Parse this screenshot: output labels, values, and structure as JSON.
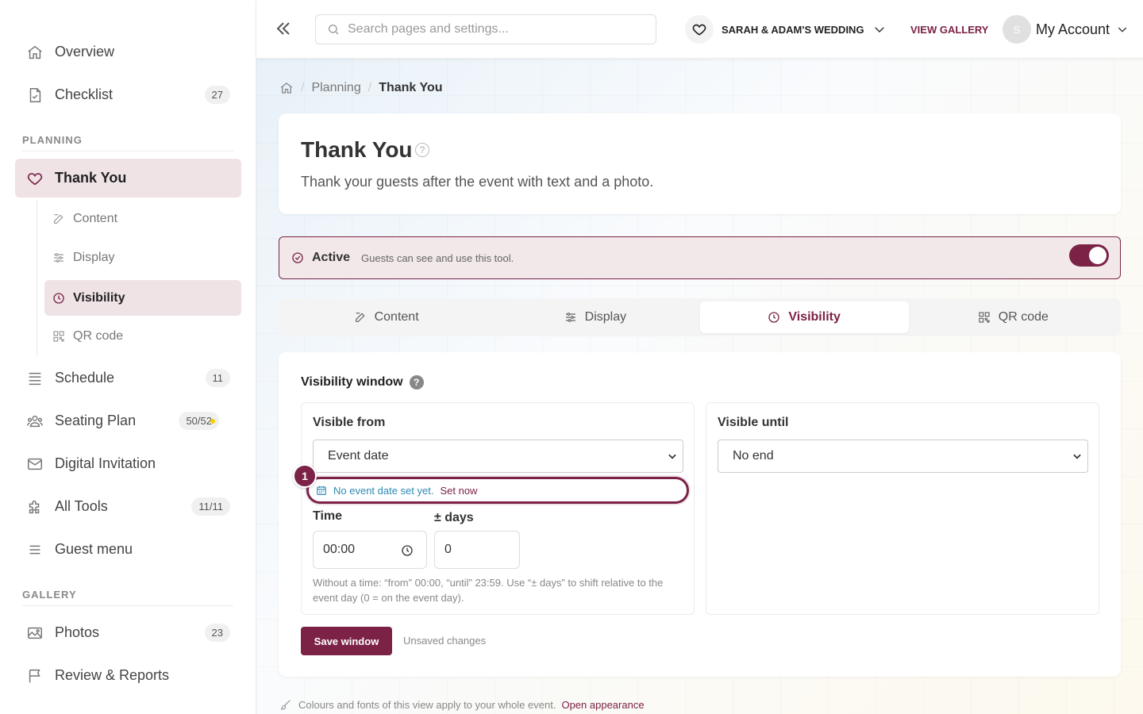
{
  "sidebar": {
    "items": [
      {
        "label": "Overview",
        "icon": "home-icon"
      },
      {
        "label": "Checklist",
        "icon": "checklist-icon",
        "badge": "27"
      }
    ],
    "planning_title": "PLANNING",
    "thank_you": {
      "label": "Thank You",
      "icon": "heart-icon"
    },
    "sub_items": [
      {
        "label": "Content",
        "icon": "edit-icon"
      },
      {
        "label": "Display",
        "icon": "sliders-icon"
      },
      {
        "label": "Visibility",
        "icon": "clock-icon"
      },
      {
        "label": "QR code",
        "icon": "qr-icon"
      }
    ],
    "planning_items": [
      {
        "label": "Schedule",
        "icon": "list-icon",
        "badge": "11"
      },
      {
        "label": "Seating Plan",
        "icon": "people-icon",
        "badge": "50/52"
      },
      {
        "label": "Digital Invitation",
        "icon": "envelope-icon"
      },
      {
        "label": "All Tools",
        "icon": "puzzle-icon",
        "badge": "11/11"
      },
      {
        "label": "Guest menu",
        "icon": "menu-icon"
      }
    ],
    "gallery_title": "GALLERY",
    "gallery_items": [
      {
        "label": "Photos",
        "icon": "image-icon",
        "badge": "23"
      },
      {
        "label": "Review & Reports",
        "icon": "flag-icon"
      }
    ]
  },
  "topbar": {
    "search_placeholder": "Search pages and settings...",
    "event_name": "SARAH & ADAM'S WEDDING",
    "view_gallery": "VIEW GALLERY",
    "avatar_initial": "S",
    "account_label": "My Account"
  },
  "breadcrumb": {
    "parent": "Planning",
    "current": "Thank You"
  },
  "page": {
    "title": "Thank You",
    "help": "?",
    "subtitle": "Thank your guests after the event with text and a photo."
  },
  "status": {
    "label": "Active",
    "description": "Guests can see and use this tool.",
    "enabled": true
  },
  "tabs": [
    {
      "label": "Content",
      "icon": "edit-icon"
    },
    {
      "label": "Display",
      "icon": "sliders-icon"
    },
    {
      "label": "Visibility",
      "icon": "clock-icon",
      "active": true
    },
    {
      "label": "QR code",
      "icon": "qr-icon"
    }
  ],
  "visibility": {
    "title": "Visibility window",
    "help": "?",
    "from": {
      "title": "Visible from",
      "selected": "Event date",
      "notice": "No event date set yet.",
      "notice_action": "Set now",
      "marker": "1",
      "time_label": "Time",
      "time_value": "00:00",
      "days_label": "± days",
      "days_value": "0",
      "hint": "Without a time: “from” 00:00, “until” 23:59. Use “± days” to shift relative to the event day (0 = on the event day)."
    },
    "until": {
      "title": "Visible until",
      "selected": "No end"
    },
    "save_label": "Save window",
    "unsaved": "Unsaved changes"
  },
  "footer": {
    "text": "Colours and fonts of this view apply to your whole event.",
    "link": "Open appearance"
  },
  "colors": {
    "accent": "#7b2246",
    "info": "#2d8ab5",
    "badge_dot": "#f5d000"
  }
}
